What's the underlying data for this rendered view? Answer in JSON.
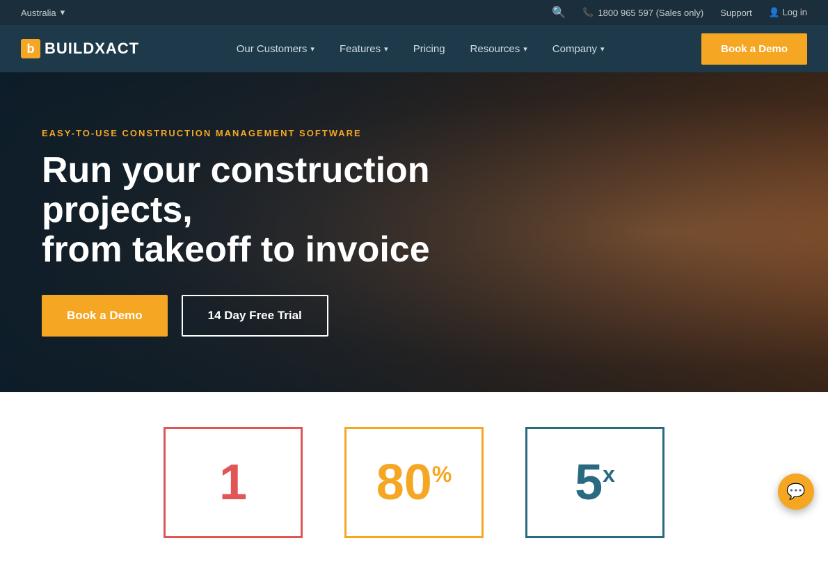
{
  "topbar": {
    "region": "Australia",
    "chevron": "▾",
    "phone": "1800 965 597 (Sales only)",
    "support": "Support",
    "login": "Log in",
    "phone_icon": "📞",
    "person_icon": "👤",
    "search_icon": "🔍"
  },
  "nav": {
    "logo_letter": "b",
    "logo_name": "BUILDXACT",
    "links": [
      {
        "label": "Our Customers",
        "has_chevron": true
      },
      {
        "label": "Features",
        "has_chevron": true
      },
      {
        "label": "Pricing",
        "has_chevron": false
      },
      {
        "label": "Resources",
        "has_chevron": true
      },
      {
        "label": "Company",
        "has_chevron": true
      }
    ],
    "cta": "Book a Demo"
  },
  "hero": {
    "tagline": "EASY-TO-USE CONSTRUCTION MANAGEMENT SOFTWARE",
    "title_line1": "Run your construction projects,",
    "title_line2": "from takeoff to invoice",
    "btn_primary": "Book a Demo",
    "btn_secondary": "14 Day Free Trial"
  },
  "stats": [
    {
      "value": "1",
      "sup": "",
      "color": "red"
    },
    {
      "value": "80",
      "sup": "%",
      "color": "yellow"
    },
    {
      "value": "5",
      "sup": "x",
      "color": "teal"
    }
  ],
  "chat_icon": "💬"
}
